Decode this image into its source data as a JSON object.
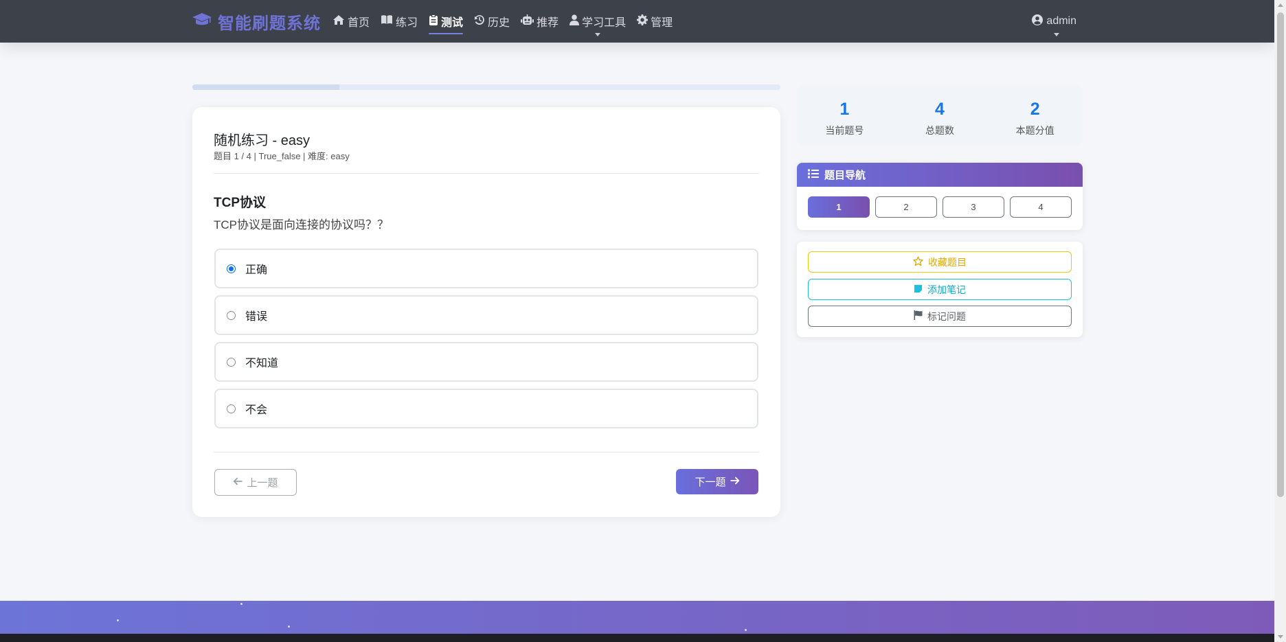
{
  "nav": {
    "brand": "智能刷题系统",
    "items": [
      {
        "label": "首页",
        "icon": "home-icon",
        "active": false
      },
      {
        "label": "练习",
        "icon": "book-icon",
        "active": false
      },
      {
        "label": "测试",
        "icon": "clipboard-icon",
        "active": true
      },
      {
        "label": "历史",
        "icon": "history-icon",
        "active": false
      },
      {
        "label": "推荐",
        "icon": "robot-icon",
        "active": false
      },
      {
        "label": "学习工具",
        "icon": "user-icon",
        "active": false,
        "dropdown": true
      },
      {
        "label": "管理",
        "icon": "gear-icon",
        "active": false
      }
    ],
    "user": "admin"
  },
  "progress": {
    "value": 0.25
  },
  "question": {
    "title": "随机练习 - easy",
    "meta": "题目 1 / 4 | True_false | 难度: easy",
    "heading": "TCP协议",
    "text": "TCP协议是面向连接的协议吗？？",
    "options": [
      {
        "label": "正确",
        "selected": true
      },
      {
        "label": "错误",
        "selected": false
      },
      {
        "label": "不知道",
        "selected": false
      },
      {
        "label": "不会",
        "selected": false
      }
    ],
    "prev_label": "上一题",
    "next_label": "下一题"
  },
  "stats": [
    {
      "value": "1",
      "label": "当前题号"
    },
    {
      "value": "4",
      "label": "总题数"
    },
    {
      "value": "2",
      "label": "本题分值"
    }
  ],
  "question_nav": {
    "title": "题目导航",
    "numbers": [
      "1",
      "2",
      "3",
      "4"
    ],
    "current": "1"
  },
  "actions": {
    "favorite": "收藏题目",
    "note": "添加笔记",
    "flag": "标记问题"
  },
  "colors": {
    "navbar": "#3d4149",
    "brand": "#6f73d6",
    "accent_start": "#6a6fdc",
    "accent_end": "#7a4fae",
    "stat_number": "#1677e8",
    "favorite": "#f5c30c",
    "note": "#1ac0dd"
  }
}
